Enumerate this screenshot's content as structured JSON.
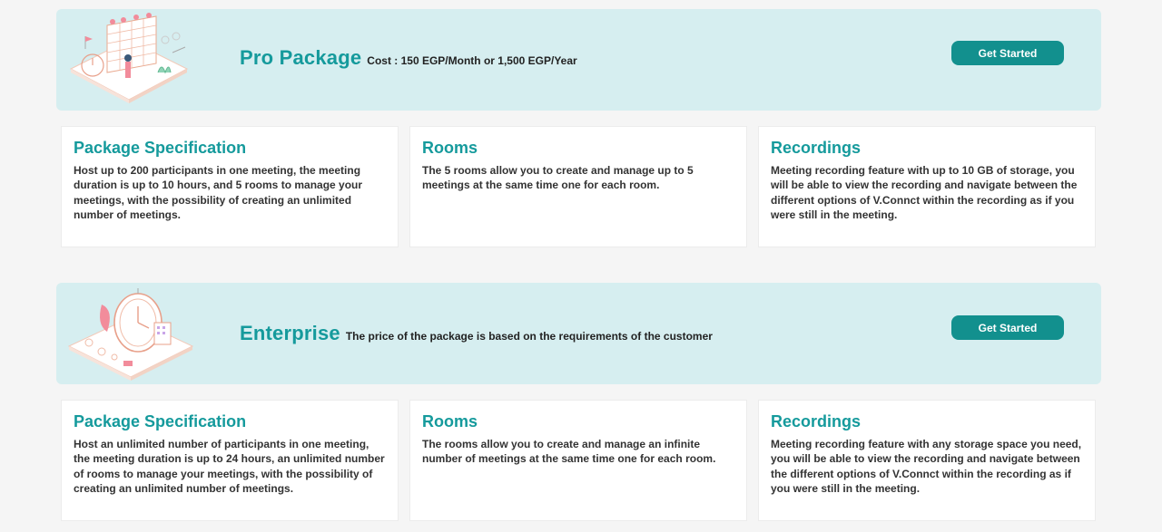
{
  "packages": [
    {
      "name": "Pro Package",
      "cost": "Cost : 150 EGP/Month or 1,500 EGP/Year",
      "button": "Get Started",
      "cards": [
        {
          "title": "Package Specification",
          "body": "Host up to 200 participants in one meeting, the meeting duration is up to 10 hours, and 5 rooms to manage your meetings, with the possibility of creating an unlimited number of meetings."
        },
        {
          "title": "Rooms",
          "body": "The 5 rooms allow you to create and manage up to 5 meetings at the same time one for each room."
        },
        {
          "title": "Recordings",
          "body": "Meeting recording feature with up to 10 GB of storage, you will be able to view the recording and navigate between the different options of V.Connct within the recording as if you were still in the meeting."
        }
      ]
    },
    {
      "name": "Enterprise",
      "cost": "The price of the package is based on the requirements of the customer",
      "button": "Get Started",
      "cards": [
        {
          "title": "Package Specification",
          "body": "Host an unlimited number of participants in one meeting, the meeting duration is up to 24 hours, an unlimited number of rooms to manage your meetings, with the possibility of creating an unlimited number of meetings."
        },
        {
          "title": "Rooms",
          "body": "The rooms allow you to create and manage an infinite number of meetings at the same time one for each room."
        },
        {
          "title": "Recordings",
          "body": "Meeting recording feature with any storage space you need, you will be able to view the recording and navigate between the different options of V.Connct within the recording as if you were still in the meeting."
        }
      ]
    }
  ],
  "colors": {
    "accent": "#159a9c",
    "button": "#12908e",
    "banner": "#d6eef0"
  },
  "icons": [
    "calendar-illustration",
    "clock-illustration"
  ]
}
